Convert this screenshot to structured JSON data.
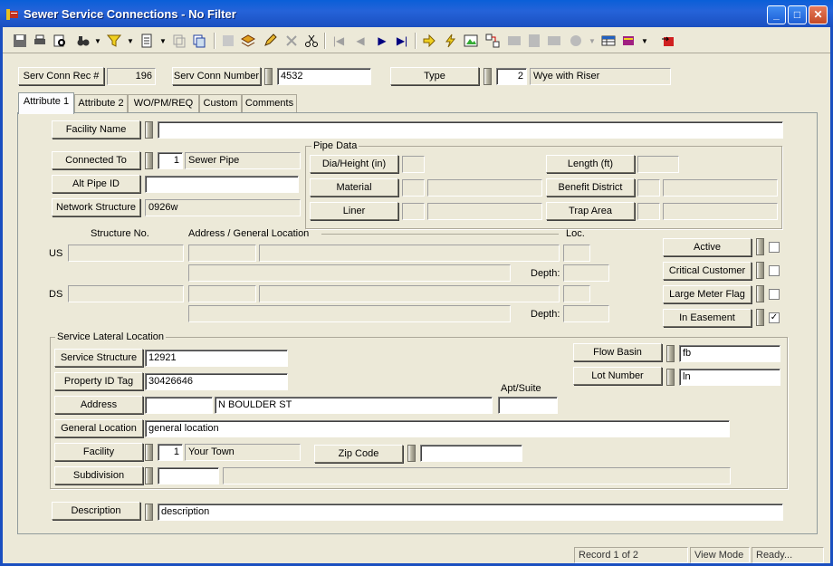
{
  "window": {
    "title": "Sewer Service Connections - No Filter",
    "min": "_",
    "max": "□",
    "close": "✕"
  },
  "toolbar": {
    "icons": [
      "save-icon",
      "print-icon",
      "print-preview-icon",
      "binoculars-icon",
      "filter-icon",
      "report-icon",
      "copy-icon",
      "duplicate-icon",
      "disabled-icon",
      "layers-icon",
      "pencil-icon",
      "delete-icon",
      "cut-icon",
      "first-record-icon",
      "previous-record-icon",
      "next-record-icon",
      "last-record-icon",
      "goto-icon",
      "lightning-icon",
      "map-icon",
      "link-icon",
      "grid-icon",
      "calculator-icon",
      "photo-icon",
      "globe-icon",
      "table-icon",
      "books-icon",
      "exit-icon"
    ]
  },
  "header": {
    "rec_label": "Serv Conn Rec #",
    "rec_value": "196",
    "number_label": "Serv Conn Number",
    "number_value": "4532",
    "type_label": "Type",
    "type_code": "2",
    "type_value": "Wye with Riser"
  },
  "tabs": [
    "Attribute 1",
    "Attribute 2",
    "WO/PM/REQ",
    "Custom",
    "Comments"
  ],
  "form": {
    "facility_name_label": "Facility Name",
    "facility_name_value": "",
    "connected_to_label": "Connected To",
    "connected_to_code": "1",
    "connected_to_value": "Sewer Pipe",
    "alt_pipe_label": "Alt Pipe ID",
    "alt_pipe_value": "",
    "network_label": "Network Structure",
    "network_value": "0926w",
    "pipe_data": {
      "title": "Pipe Data",
      "dia_label": "Dia/Height (in)",
      "material_label": "Material",
      "liner_label": "Liner",
      "length_label": "Length (ft)",
      "benefit_label": "Benefit District",
      "trap_label": "Trap Area"
    },
    "structure_no_label": "Structure No.",
    "address_label": "Address / General Location",
    "loc_label": "Loc.",
    "us_label": "US",
    "ds_label": "DS",
    "depth_label": "Depth:",
    "flags": {
      "active": "Active",
      "critical": "Critical Customer",
      "large_meter": "Large Meter Flag",
      "easement": "In Easement",
      "easement_check": "✓"
    },
    "lateral": {
      "title": "Service Lateral Location",
      "service_structure_label": "Service Structure",
      "service_structure_value": "12921",
      "property_label": "Property ID Tag",
      "property_value": "30426646",
      "apt_label": "Apt/Suite",
      "address_label": "Address",
      "address_num": "",
      "address_street": "N BOULDER ST",
      "general_label": "General Location",
      "general_value": "general location",
      "facility_label": "Facility",
      "facility_code": "1",
      "facility_value": "Your Town",
      "zip_label": "Zip Code",
      "zip_value": "",
      "subdivision_label": "Subdivision",
      "flow_label": "Flow Basin",
      "flow_value": "fb",
      "lot_label": "Lot Number",
      "lot_value": "ln"
    },
    "description_label": "Description",
    "description_value": "description"
  },
  "status": {
    "record": "Record 1 of 2",
    "mode": "View Mode",
    "state": "Ready..."
  }
}
